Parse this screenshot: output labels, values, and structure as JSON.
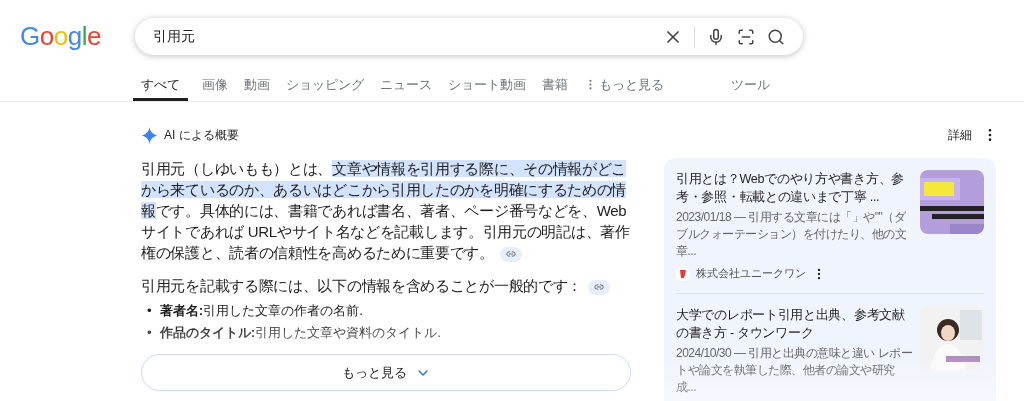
{
  "logo": "Google",
  "search": {
    "value": "引用元"
  },
  "tabs": [
    {
      "label": "すべて",
      "selected": true
    },
    {
      "label": "画像",
      "selected": false
    },
    {
      "label": "動画",
      "selected": false
    },
    {
      "label": "ショッピング",
      "selected": false
    },
    {
      "label": "ニュース",
      "selected": false
    },
    {
      "label": "ショート動画",
      "selected": false
    },
    {
      "label": "書籍",
      "selected": false
    }
  ],
  "more_tab": "もっと見る",
  "tools": "ツール",
  "ai_overview": {
    "title": "AI による概要",
    "paragraph": [
      {
        "text": "引用元（しゆいもも）とは、",
        "highlighted": false
      },
      {
        "text": "文章や情報を引用する際に、その情報がどこから来ているのか、あるいはどこから引用したのかを明確にするための情報",
        "highlighted": true
      },
      {
        "text": "です。具体的には、書籍であれば書名、著者、ページ番号などを、Webサイトであれば URLやサイト名などを記載します。引用元の明記は、著作権の保護と、読者の信頼性を高めるために重要です。",
        "highlighted": false
      }
    ],
    "intro": "引用元を記載する際には、以下の情報を含めることが一般的です：",
    "bullets": [
      {
        "marker": "•",
        "term": "著者名:",
        "text": "引用した文章の作者の名前."
      },
      {
        "marker": "•",
        "term": "作品のタイトル:",
        "text": "引用した文章や資料のタイトル."
      }
    ],
    "show_more": "もっと見る"
  },
  "details": "詳細",
  "sources": [
    {
      "title": "引用とは？Webでのやり方や書き方、参考・参照・転載との違いまで丁寧 ...",
      "snippet": "2023/01/18 — 引用する文章には「」や\"\"（ダブルクォーテーション）を付けたり、他の文章...",
      "site": "株式会社ユニークワン"
    },
    {
      "title": "大学でのレポート引用と出典、参考文献の書き方 - タウンワーク",
      "snippet": "2024/10/30 — 引用と出典の意味と違い レポートや論文を執筆した際、他者の論文や研究成..."
    }
  ]
}
